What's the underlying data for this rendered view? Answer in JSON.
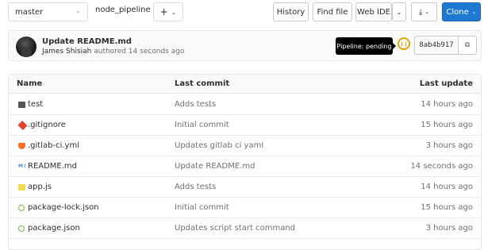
{
  "toolbar": {
    "branch": "master",
    "path_segment": "node_pipeline",
    "path_separator": "/",
    "add_label": "+",
    "history_label": "History",
    "find_file_label": "Find file",
    "web_ide_label": "Web IDE",
    "clone_label": "Clone"
  },
  "commit": {
    "title": "Update README.md",
    "author": "James Shisiah",
    "meta": "authored 14 seconds ago",
    "pipeline_tooltip": "Pipeline: pending",
    "sha": "8ab4b917"
  },
  "table": {
    "headers": {
      "name": "Name",
      "last_commit": "Last commit",
      "last_update": "Last update"
    },
    "rows": [
      {
        "name": "test",
        "icon": "folder-icon",
        "message": "Adds tests",
        "updated": "14 hours ago"
      },
      {
        "name": ".gitignore",
        "icon": "git-icon",
        "message": "Initial commit",
        "updated": "15 hours ago"
      },
      {
        "name": ".gitlab-ci.yml",
        "icon": "gitlab-icon",
        "message": "Updates gitlab ci yaml",
        "updated": "3 hours ago"
      },
      {
        "name": "README.md",
        "icon": "markdown-icon",
        "message": "Update README.md",
        "updated": "14 seconds ago"
      },
      {
        "name": "app.js",
        "icon": "javascript-icon",
        "message": "Adds tests",
        "updated": "14 hours ago"
      },
      {
        "name": "package-lock.json",
        "icon": "npm-icon",
        "message": "Initial commit",
        "updated": "15 hours ago"
      },
      {
        "name": "package.json",
        "icon": "npm-icon",
        "message": "Updates script start command",
        "updated": "3 hours ago"
      }
    ]
  },
  "colors": {
    "clone_button": "#1f78d1",
    "pipeline_pending": "#e2a500"
  }
}
